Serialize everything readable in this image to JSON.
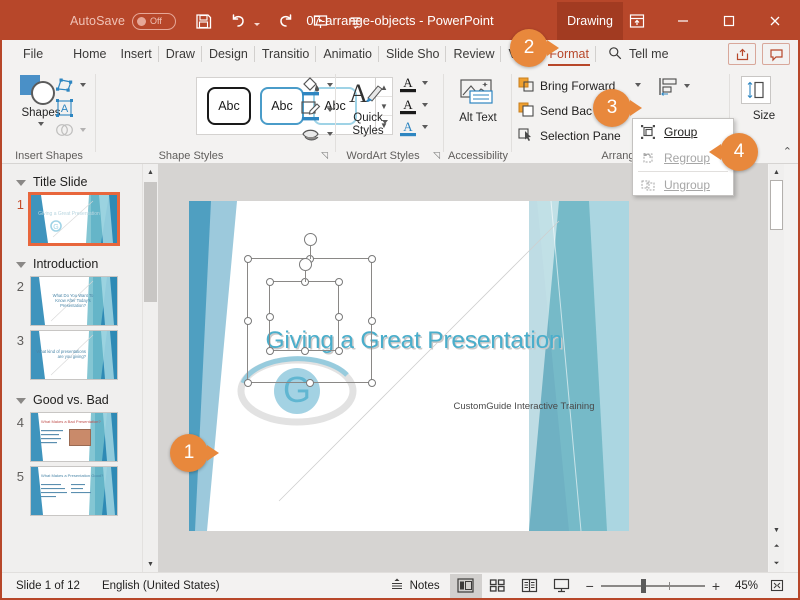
{
  "titlebar": {
    "autosave_label": "AutoSave",
    "autosave_state": "Off",
    "document_title": "07-arrange-objects  -  PowerPoint",
    "drawing_tab": "Drawing",
    "qat_icons": [
      "save-icon",
      "undo-icon",
      "redo-icon",
      "start-presentation-icon",
      "customize-qat-icon"
    ],
    "window_buttons": [
      "ribbon-display-options-icon",
      "minimize-icon",
      "maximize-icon",
      "close-icon"
    ],
    "brand_color": "#B7472A"
  },
  "tabs": [
    {
      "label": "File",
      "active": false
    },
    {
      "label": "Home",
      "active": false
    },
    {
      "label": "Insert",
      "active": false
    },
    {
      "label": "Draw",
      "active": false
    },
    {
      "label": "Design",
      "active": false
    },
    {
      "label": "Transitio",
      "active": false
    },
    {
      "label": "Animatio",
      "active": false
    },
    {
      "label": "Slide Sho",
      "active": false
    },
    {
      "label": "Review",
      "active": false
    },
    {
      "label": "View",
      "active": false
    },
    {
      "label": "Format",
      "active": true
    }
  ],
  "tellme": {
    "label": "Tell me",
    "icon": "search-icon"
  },
  "ribbon": {
    "insert_shapes": {
      "group_label": "Insert Shapes",
      "shapes_button": "Shapes",
      "tools": [
        "edit-shape-icon",
        "text-box-icon",
        "merge-shapes-icon"
      ]
    },
    "shape_styles": {
      "group_label": "Shape Styles",
      "gallery_items": [
        "Abc",
        "Abc",
        "Abc"
      ],
      "side_tools": [
        "shape-fill-icon",
        "shape-outline-icon",
        "shape-effects-icon"
      ]
    },
    "wordart_styles": {
      "group_label": "WordArt Styles",
      "quick_styles_label": "Quick Styles",
      "side_tools": [
        "text-fill-icon",
        "text-outline-icon",
        "text-effects-icon"
      ]
    },
    "accessibility": {
      "group_label": "Accessibility",
      "alt_text_label": "Alt Text"
    },
    "arrange": {
      "group_label": "Arrange",
      "items": [
        {
          "label": "Bring Forward",
          "icon": "bring-forward-icon",
          "has_caret": true
        },
        {
          "label": "Send Bac",
          "icon": "send-backward-icon",
          "has_caret": true
        },
        {
          "label": "Selection Pane",
          "icon": "selection-pane-icon",
          "has_caret": false
        }
      ],
      "align_button": "align-objects-icon",
      "group_button": "group-objects-icon"
    },
    "size": {
      "group_label": "Size",
      "icon": "size-icon"
    }
  },
  "dropdown": {
    "items": [
      {
        "label": "Group",
        "icon": "group-icon",
        "disabled": false
      },
      {
        "label": "Regroup",
        "icon": "regroup-icon",
        "disabled": true
      },
      {
        "label": "Ungroup",
        "icon": "ungroup-icon",
        "disabled": true
      }
    ]
  },
  "callouts": [
    {
      "number": "1",
      "target": "selected-shapes-on-slide"
    },
    {
      "number": "2",
      "target": "format-tab"
    },
    {
      "number": "3",
      "target": "group-dropdown-button"
    },
    {
      "number": "4",
      "target": "group-menu-item"
    }
  ],
  "slide_panel": {
    "sections": [
      {
        "title": "Title Slide",
        "slides": [
          {
            "number": "1",
            "selected": true
          }
        ]
      },
      {
        "title": "Introduction",
        "slides": [
          {
            "number": "2",
            "selected": false,
            "text": "What Do You Want To Know After Today's Presentation?"
          },
          {
            "number": "3",
            "selected": false,
            "text": "What kind of presentations are you giving?"
          }
        ]
      },
      {
        "title": "Good vs. Bad",
        "slides": [
          {
            "number": "4",
            "selected": false,
            "text": "What Makes a Bad Presentation?"
          },
          {
            "number": "5",
            "selected": false,
            "text": "What Makes a Presentation Good?"
          }
        ]
      }
    ]
  },
  "slide": {
    "title": "Giving a Great Presentation",
    "subtitle": "CustomGuide Interactive Training",
    "title_color": "#4AAECB"
  },
  "statusbar": {
    "slide_count": "Slide 1 of 12",
    "language": "English (United States)",
    "notes_label": "Notes",
    "views": [
      {
        "name": "normal-view",
        "active": true
      },
      {
        "name": "slide-sorter-view",
        "active": false
      },
      {
        "name": "reading-view",
        "active": false
      },
      {
        "name": "slide-show-view",
        "active": false
      }
    ],
    "zoom_out": "−",
    "zoom_in": "+",
    "zoom_level": "45%",
    "fit_button": "fit-slide-to-window-icon"
  }
}
